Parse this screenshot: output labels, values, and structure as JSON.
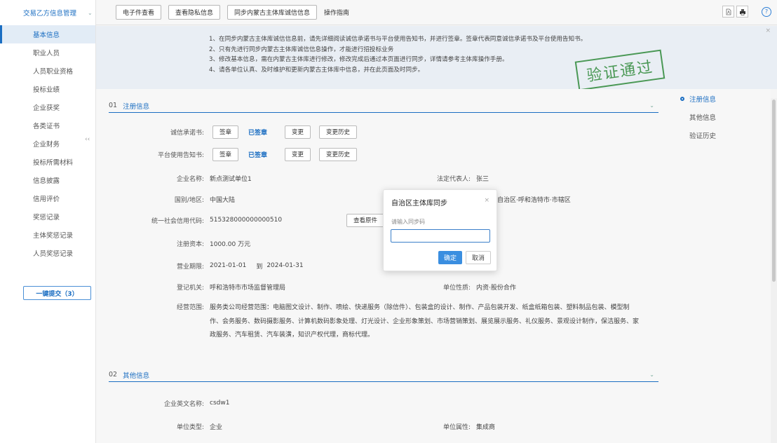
{
  "sidebar": {
    "group_label": "交易乙方信息管理",
    "items": [
      {
        "label": "基本信息"
      },
      {
        "label": "职业人员"
      },
      {
        "label": "人员职业资格"
      },
      {
        "label": "投标业绩"
      },
      {
        "label": "企业获奖"
      },
      {
        "label": "各类证书"
      },
      {
        "label": "企业财务"
      },
      {
        "label": "投标所需材料"
      },
      {
        "label": "信息披露"
      },
      {
        "label": "信用评价"
      },
      {
        "label": "奖惩记录"
      },
      {
        "label": "主体奖惩记录"
      },
      {
        "label": "人员奖惩记录"
      }
    ],
    "submit_label": "一键提交（3）",
    "collapse_glyph": "‹‹"
  },
  "toolbar": {
    "btn_doc": "电子件查看",
    "btn_privacy": "查看隐私信息",
    "btn_sync": "同步内蒙古主体库诚信信息",
    "guide": "操作指南"
  },
  "notice": {
    "lines": [
      "1、在同步内蒙古主体库诚信信息前，请先详细阅读诚信承诺书与平台使用告知书，并进行签章。签章代表同意诚信承诺书及平台使用告知书。",
      "2、只有先进行同步内蒙古主体库诚信信息操作，才能进行招投标业务",
      "3、修改基本信息，需在内蒙古主体库进行修改，修改完成后通过本页面进行同步，详情请参考主体库操作手册。",
      "4、请各单位认真、及时维护和更新内蒙古主体库中信息，并在此页面及时同步。"
    ],
    "stamp": "验证通过"
  },
  "section1": {
    "num": "01",
    "title": "注册信息",
    "pledge": {
      "label": "诚信承诺书:",
      "sign": "签章",
      "status": "已签章",
      "change": "变更",
      "history": "变更历史"
    },
    "notice_doc": {
      "label": "平台使用告知书:",
      "sign": "签章",
      "status": "已签章",
      "change": "变更",
      "history": "变更历史"
    },
    "company_name": {
      "label": "企业名称:",
      "value": "新点测试单位1"
    },
    "legal_rep": {
      "label": "法定代表人:",
      "value": "张三"
    },
    "country": {
      "label": "国别/地区:",
      "value": "中国大陆"
    },
    "region_value": "自治区·呼和浩特市·市辖区",
    "credit_code": {
      "label": "统一社会信用代码:",
      "value": "515328000000000510",
      "view_btn": "查看原件"
    },
    "capital": {
      "label": "注册资本:",
      "value": "1000.00 万元"
    },
    "period": {
      "label": "营业期限:",
      "start": "2021-01-01",
      "sep": "到",
      "end": "2024-01-31"
    },
    "authority": {
      "label": "登记机关:",
      "value": "呼和浩特市市场监督管理局"
    },
    "nature": {
      "label": "单位性质:",
      "value": "内资·股份合作"
    },
    "scope": {
      "label": "经营范围:",
      "lines": [
        "服务类公司经营范围：电脑图文设计、制作、喷绘、快递服务（除信件）、包装盒的设计、制作、产品包装开发、纸盒纸箱包装、塑料制品包装、模型制",
        "作、会务服务、数码摄影服务、计算机数码影象处理、灯光设计、企业形象策划、市场营销策划、展览展示服务、礼仪服务、景观设计制作，保洁服务、家",
        "政服务、汽车租赁、汽车装潢，知识产权代理，商标代理。"
      ]
    }
  },
  "section2": {
    "num": "02",
    "title": "其他信息",
    "english_name": {
      "label": "企业英文名称:",
      "value": "csdw1"
    },
    "unit_type": {
      "label": "单位类型:",
      "value": "企业"
    },
    "unit_attr": {
      "label": "单位属性:",
      "value": "集成商"
    }
  },
  "rightnav": {
    "items": [
      {
        "label": "注册信息"
      },
      {
        "label": "其他信息"
      },
      {
        "label": "验证历史"
      }
    ]
  },
  "dialog": {
    "title": "自治区主体库同步",
    "close": "×",
    "hint": "请输入同步码",
    "input_value": "",
    "ok": "确定",
    "cancel": "取消"
  },
  "colors": {
    "accent": "#1b6ec2",
    "stamp": "#2f8a3a",
    "primary_button": "#3a8ee0"
  }
}
